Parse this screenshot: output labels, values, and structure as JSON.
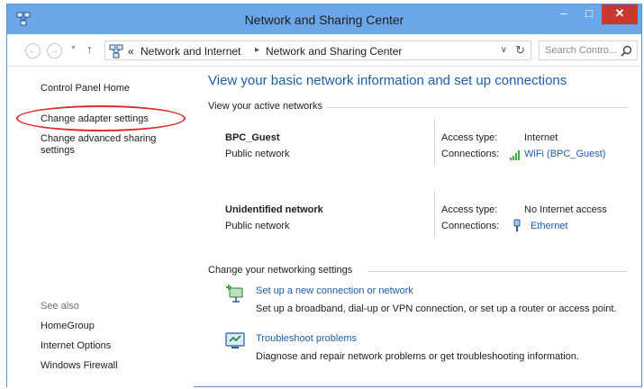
{
  "window": {
    "title": "Network and Sharing Center",
    "controls": {
      "minimize": "–",
      "maximize": "□",
      "close": "✕"
    },
    "icon": "network-center-icon"
  },
  "nav": {
    "back_icon": "back-arrow-icon",
    "forward_icon": "forward-arrow-icon",
    "up_icon": "up-arrow-icon",
    "breadcrumb": [
      "«",
      "Network and Internet",
      "Network and Sharing Center"
    ],
    "refresh_icon": "refresh-icon",
    "search_placeholder": "Search Contro..."
  },
  "left_pane": {
    "home_link": "Control Panel Home",
    "adapter_link": "Change adapter settings",
    "sharing_link_line1": "Change advanced sharing",
    "sharing_link_line2": "settings",
    "see_also_label": "See also",
    "see_also": [
      "HomeGroup",
      "Internet Options",
      "Windows Firewall"
    ],
    "highlight_color": "#e22a2a"
  },
  "main": {
    "title": "View your basic network information and set up connections",
    "active_label": "View your active networks",
    "networks": [
      {
        "name": "BPC_Guest",
        "type": "Public network",
        "access_key": "Access type:",
        "access_value": "Internet",
        "conn_key": "Connections:",
        "conn_value": "WiFi (BPC_Guest)",
        "conn_icon": "wifi-signal-icon"
      },
      {
        "name": "Unidentified network",
        "type": "Public network",
        "access_key": "Access type:",
        "access_value": "No Internet access",
        "conn_key": "Connections:",
        "conn_value": "Ethernet",
        "conn_icon": "ethernet-icon"
      }
    ],
    "change_label": "Change your networking settings",
    "tasks": [
      {
        "link": "Set up a new connection or network",
        "desc": "Set up a broadband, dial-up or VPN connection, or set up a router or access point.",
        "icon": "new-connection-icon"
      },
      {
        "link": "Troubleshoot problems",
        "desc": "Diagnose and repair network problems or get troubleshooting information.",
        "icon": "troubleshoot-icon"
      }
    ]
  },
  "colors": {
    "link": "#1d5ea8",
    "titlebar": "#6aa6e8",
    "close": "#c8392f"
  }
}
